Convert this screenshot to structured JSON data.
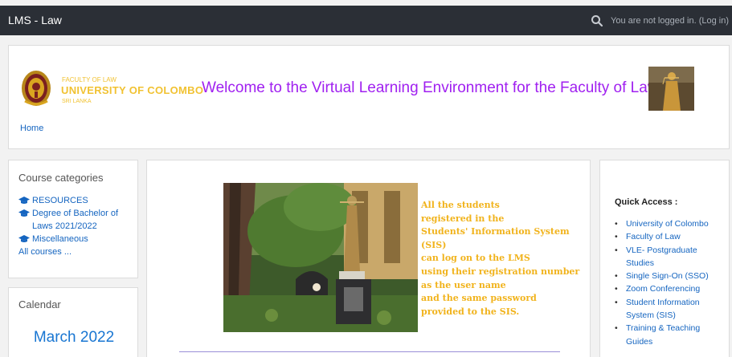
{
  "topbar": {
    "brand": "LMS - Law",
    "login_status": "You are not logged in. (Log in)"
  },
  "header": {
    "faculty_line": "FACULTY OF LAW",
    "university_line": "UNIVERSITY OF COLOMBO",
    "country_line": "SRI LANKA",
    "welcome": "Welcome to the Virtual Learning Environment for the Faculty of Law",
    "breadcrumb_home": "Home"
  },
  "course_categories": {
    "title": "Course categories",
    "items": [
      {
        "label": "RESOURCES",
        "icon": "graduation-cap-icon"
      },
      {
        "label": "Degree of Bachelor of Laws 2021/2022",
        "icon": "graduation-cap-icon"
      },
      {
        "label": "Miscellaneous",
        "icon": "graduation-cap-icon"
      }
    ],
    "all_courses": "All courses ..."
  },
  "calendar": {
    "title": "Calendar",
    "month": "March 2022"
  },
  "main": {
    "notice_lines": [
      "All the students",
      "registered in the",
      "Students' Information System",
      "(SIS)",
      "can log on to the LMS",
      "using their registration number",
      "as the user name",
      "and the same password",
      "provided to the SIS."
    ]
  },
  "quick_access": {
    "title": "Quick Access :",
    "links": [
      "University of Colombo",
      "Faculty of Law",
      "VLE- Postgraduate Studies",
      "Single Sign-On (SSO)",
      "Zoom Conferencing",
      "Student Information System (SIS)",
      "Training & Teaching Guides"
    ]
  },
  "colors": {
    "topbar": "#2b2f36",
    "link": "#1565c0",
    "welcome": "#a020f0",
    "notice": "#f1b31c",
    "logo_gold": "#f1c232"
  }
}
